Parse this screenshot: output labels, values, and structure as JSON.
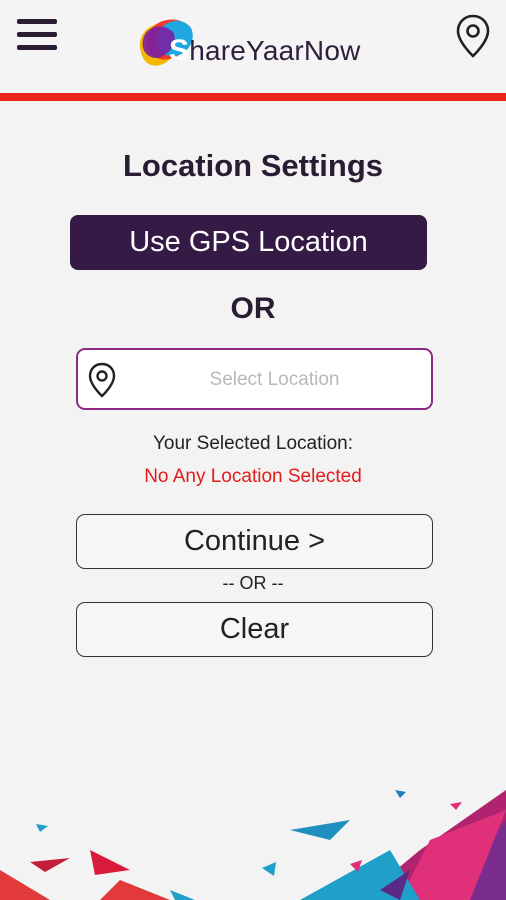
{
  "header": {
    "brand_initial": "S",
    "brand_rest": "hareYaarNow",
    "menu_icon": "hamburger-menu-icon",
    "location_icon": "map-pin-icon"
  },
  "main": {
    "title": "Location Settings",
    "gps_button": "Use GPS Location",
    "or_label": "OR",
    "location_input": {
      "placeholder": "Select Location",
      "value": "",
      "icon": "map-pin-icon"
    },
    "selected_label": "Your Selected Location:",
    "selected_value": "No Any Location Selected",
    "continue_button": "Continue >",
    "or_separator": "-- OR --",
    "clear_button": "Clear"
  },
  "colors": {
    "accent_bar": "#e8261c",
    "primary_button": "#341a45",
    "input_border": "#8e2a85",
    "status_red": "#e51b1b"
  }
}
